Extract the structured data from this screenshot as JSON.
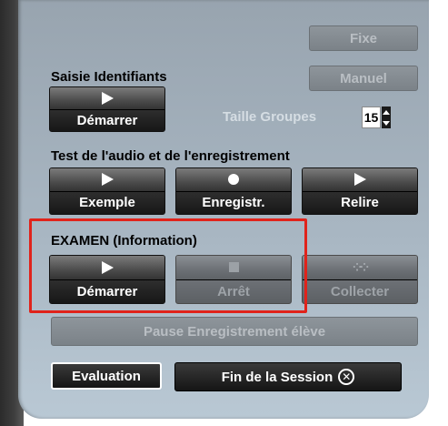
{
  "top_buttons": {
    "fixe": "Fixe",
    "manuel": "Manuel"
  },
  "saisie": {
    "title": "Saisie Identifiants",
    "start": "Démarrer"
  },
  "groupes": {
    "label": "Taille Groupes",
    "value": "15"
  },
  "audio_test": {
    "title": "Test de l'audio et de l'enregistrement",
    "exemple": "Exemple",
    "enregistr": "Enregistr.",
    "relire": "Relire"
  },
  "examen": {
    "title": "EXAMEN  (Information)",
    "start": "Démarrer",
    "stop": "Arrêt",
    "collect": "Collecter"
  },
  "pause": "Pause Enregistrement élève",
  "evaluation": "Evaluation",
  "fin_session": "Fin de la Session",
  "colors": {
    "highlight": "#e0231b",
    "panel": "#a8b6c2"
  }
}
